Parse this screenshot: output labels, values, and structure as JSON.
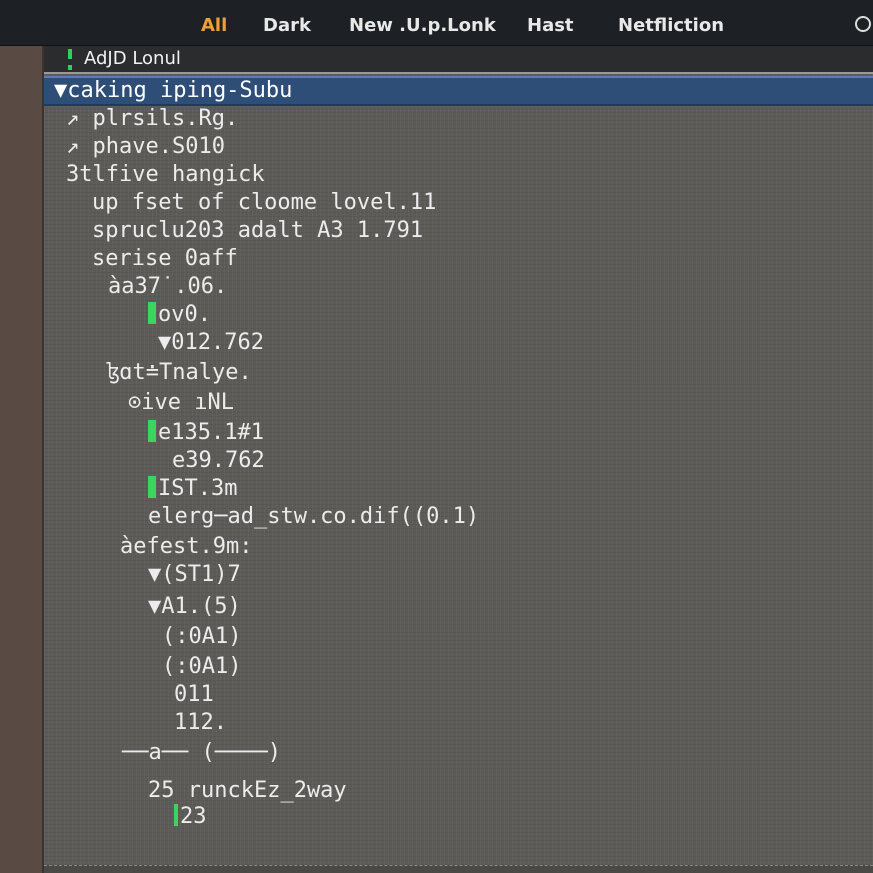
{
  "menubar": {
    "items": [
      "All",
      "Dark",
      "New .U.p.Lonk",
      "Hast",
      "Netfliction"
    ]
  },
  "file_tab": {
    "label": "AdJD Lonul"
  },
  "tree": {
    "selected": "▼caking iping-Subu",
    "lines": [
      "↗ plrsils.Rg.",
      "↗ phave.S010",
      "3tlfive hangick",
      "up fset of cloome lovel.11",
      "spruclu203 adalt A3 1.791",
      "serise 0aff",
      "àa37˙.06.",
      "ov0.",
      "▼012.762",
      "ɮɑt≐Tnalye.",
      "⊙ive ıNL",
      "e135.1#1",
      "e39.762",
      "IST.3m",
      "elerg─ad_stw.co.dif((0.1)",
      "àefest.9m:",
      "▼(ST1)7",
      "▼A1.(5)",
      "(:0A1)",
      "(:0A1)",
      "011",
      "112.",
      "──a── (────)",
      "25 runckEz_2way",
      "23"
    ]
  },
  "colors": {
    "menubar_bg": "#1d2024",
    "active_menu": "#f0a030",
    "selection": "#2e4e78",
    "change_marker": "#3ad45e"
  }
}
